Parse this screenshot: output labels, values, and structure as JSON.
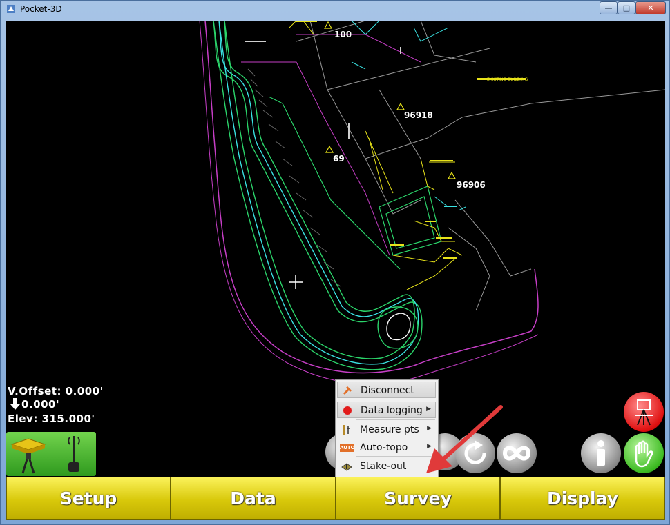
{
  "window": {
    "title": "Pocket-3D",
    "controls": {
      "minimize": "—",
      "maximize": "□",
      "close": "✕"
    }
  },
  "map": {
    "point_labels": [
      "100",
      "96918",
      "69",
      "96906"
    ],
    "annotation": "EXISTING BUILDING"
  },
  "readouts": {
    "v_offset": "V.Offset: 0.000'",
    "cut_fill": "0.000'",
    "elevation": "Elev: 315.000'"
  },
  "context_menu": {
    "items": [
      {
        "label": "Disconnect",
        "icon": "disconnect-icon",
        "submenu": false
      },
      {
        "label": "Data logging",
        "icon": "record-icon",
        "submenu": true
      },
      {
        "label": "Measure pts",
        "icon": "measure-pole-icon",
        "submenu": true
      },
      {
        "label": "Auto-topo",
        "icon": "auto-badge-icon",
        "submenu": true
      },
      {
        "label": "Stake-out",
        "icon": "stakeout-icon",
        "submenu": false
      }
    ],
    "auto_badge": "AUTO",
    "submenu_arrow": "▶"
  },
  "bottom_bar": {
    "setup": "Setup",
    "data": "Data",
    "survey": "Survey",
    "display": "Display"
  },
  "colors": {
    "map_bg": "#000000",
    "button_yellow": "#e6d81a",
    "gps_green": "#4cc035",
    "annotation_arrow": "#e03a3a",
    "menu_bg": "#f0f0f0"
  }
}
